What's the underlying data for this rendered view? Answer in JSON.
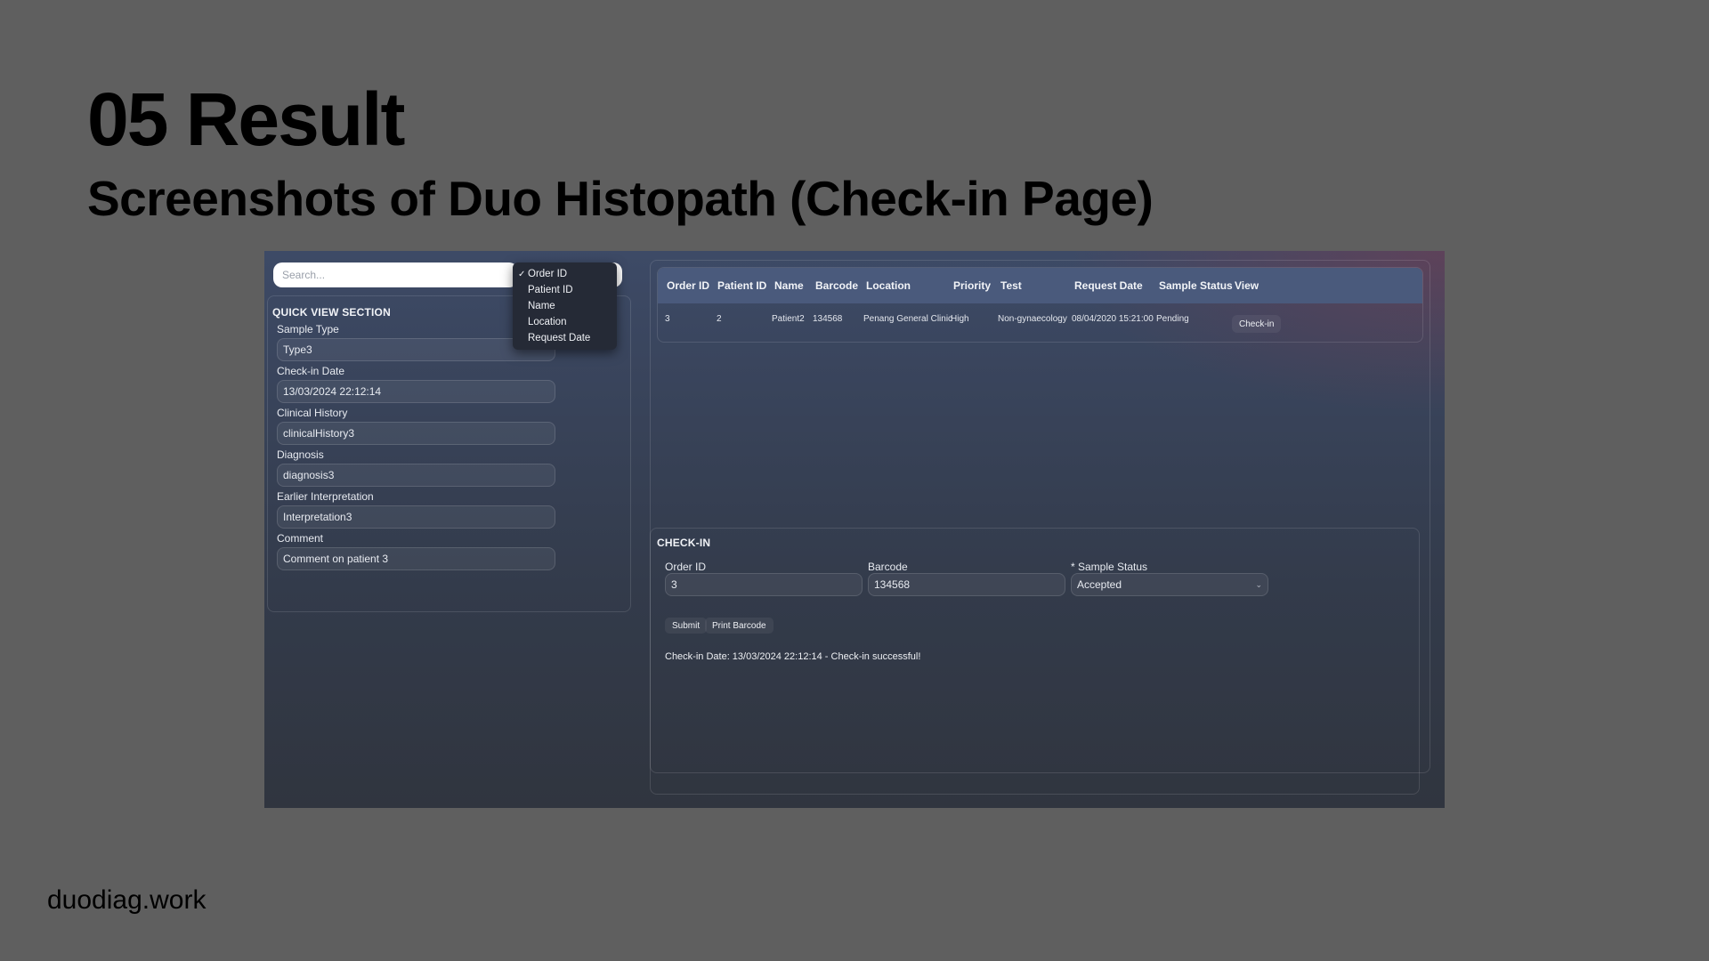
{
  "slide": {
    "title": "05 Result",
    "subtitle": "Screenshots of Duo Histopath (Check-in Page)",
    "footer": "duodiag.work"
  },
  "search": {
    "placeholder": "Search...",
    "options": [
      {
        "label": "Order ID",
        "selected": true
      },
      {
        "label": "Patient ID",
        "selected": false
      },
      {
        "label": "Name",
        "selected": false
      },
      {
        "label": "Location",
        "selected": false
      },
      {
        "label": "Request Date",
        "selected": false
      }
    ]
  },
  "quick_view": {
    "title": "QUICK VIEW SECTION",
    "fields": [
      {
        "label": "Sample Type",
        "value": "Type3"
      },
      {
        "label": "Check-in Date",
        "value": "13/03/2024 22:12:14"
      },
      {
        "label": "Clinical History",
        "value": "clinicalHistory3"
      },
      {
        "label": "Diagnosis",
        "value": "diagnosis3"
      },
      {
        "label": "Earlier Interpretation",
        "value": "Interpretation3"
      },
      {
        "label": "Comment",
        "value": "Comment on patient 3"
      }
    ]
  },
  "table": {
    "columns": [
      "Order ID",
      "Patient ID",
      "Name",
      "Barcode",
      "Location",
      "Priority",
      "Test",
      "Request Date",
      "Sample Status",
      "View"
    ],
    "rows": [
      {
        "cells": [
          "3",
          "2",
          "Patient2",
          "134568",
          "Penang General Clinic",
          "High",
          "Non-gynaecology",
          "08/04/2020 15:21:00",
          "Pending"
        ],
        "action": "Check-in"
      }
    ]
  },
  "checkin": {
    "title": "CHECK-IN",
    "order_id": {
      "label": "Order ID",
      "value": "3"
    },
    "barcode": {
      "label": "Barcode",
      "value": "134568"
    },
    "sample_status": {
      "label": "* Sample Status",
      "value": "Accepted"
    },
    "submit_label": "Submit",
    "print_label": "Print Barcode",
    "message": "Check-in Date: 13/03/2024 22:12:14 - Check-in successful!"
  },
  "icons": {
    "checkmark": "checkmark-icon",
    "chevron": "chevron-down-icon"
  },
  "colors": {
    "slide_background": "#5f5f5f",
    "table_header": "#4a5a7c"
  }
}
